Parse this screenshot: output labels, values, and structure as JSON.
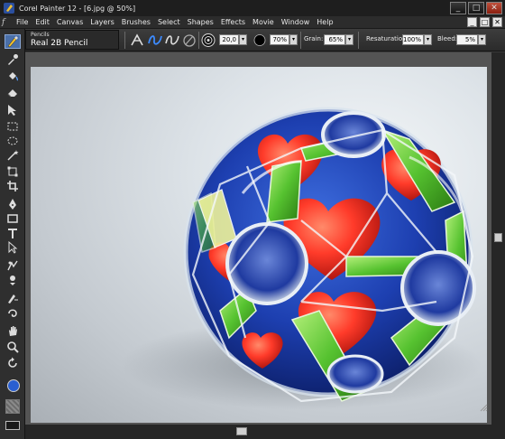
{
  "window": {
    "title": "Corel Painter 12 - [6.jpg @ 50%]",
    "controls": [
      "_",
      "□",
      "✕"
    ]
  },
  "menu": {
    "logo": "f",
    "items": [
      "File",
      "Edit",
      "Canvas",
      "Layers",
      "Brushes",
      "Select",
      "Shapes",
      "Effects",
      "Movie",
      "Window",
      "Help"
    ],
    "doc_controls": [
      "_",
      "□",
      "✕"
    ]
  },
  "property_bar": {
    "brush_category": "Pencils",
    "brush_variant": "Real 2B Pencil",
    "size_value": "20,0",
    "opacity_value": "70%",
    "grain_label": "Grain:",
    "grain_value": "65%",
    "resaturation_label": "Resaturation:",
    "resaturation_value": "100%",
    "bleed_label": "Bleed:",
    "bleed_value": "5%",
    "dropdown_glyph": "▾"
  },
  "toolbox": {
    "tools": [
      "brush-tool",
      "dropper-tool",
      "paint-bucket-tool",
      "eraser-tool",
      "layer-adjuster-tool",
      "rectangular-selection-tool",
      "oval-selection-tool",
      "magic-wand-tool",
      "transform-tool",
      "crop-tool",
      "pen-tool",
      "rectangle-shape-tool",
      "text-tool",
      "shape-selection-tool",
      "divine-proportion-tool",
      "mirror-tool",
      "cloner-tool",
      "blur-tool",
      "grabber-tool",
      "magnifier-tool",
      "rotate-page-tool"
    ],
    "main_color": "#2a5fd0",
    "paper_color": "#8a8a8a"
  },
  "document": {
    "image_subject": "glass-polyhedron-sphere"
  }
}
